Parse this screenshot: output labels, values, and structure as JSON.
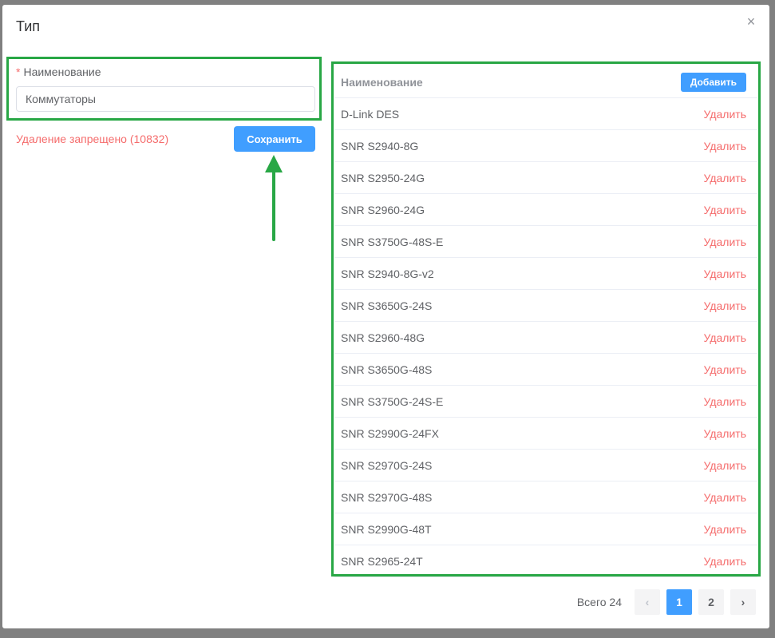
{
  "modal": {
    "title": "Тип"
  },
  "form": {
    "required_mark": "*",
    "label": "Наименование",
    "value": "Коммутаторы",
    "delete_forbidden": "Удаление запрещено (10832)",
    "save_label": "Сохранить"
  },
  "table": {
    "header": "Наименование",
    "add_label": "Добавить",
    "delete_label": "Удалить",
    "rows": [
      "D-Link DES",
      "SNR S2940-8G",
      "SNR S2950-24G",
      "SNR S2960-24G",
      "SNR S3750G-48S-E",
      "SNR S2940-8G-v2",
      "SNR S3650G-24S",
      "SNR S2960-48G",
      "SNR S3650G-48S",
      "SNR S3750G-24S-E",
      "SNR S2990G-24FX",
      "SNR S2970G-24S",
      "SNR S2970G-48S",
      "SNR S2990G-48T",
      "SNR S2965-24T"
    ]
  },
  "pagination": {
    "total": "Всего 24",
    "pages": [
      "1",
      "2"
    ],
    "current": "1"
  },
  "colors": {
    "highlight": "#28a745",
    "primary": "#409eff",
    "danger": "#f56c6c"
  },
  "icons": {
    "close": "close-icon",
    "prev": "chevron-left-icon",
    "next": "chevron-right-icon",
    "arrow": "arrow-up-icon"
  }
}
